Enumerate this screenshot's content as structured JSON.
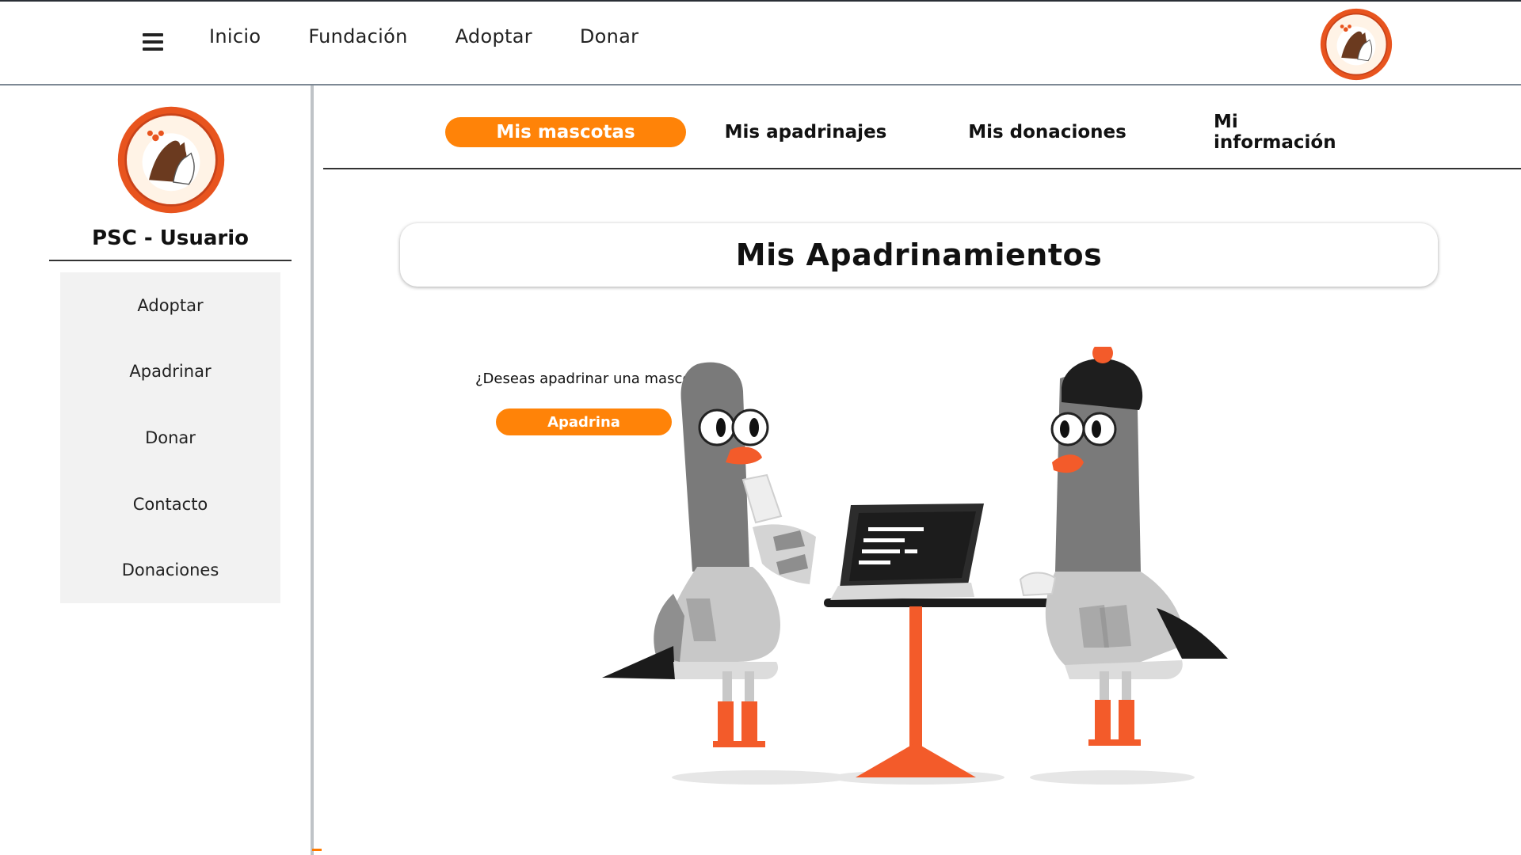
{
  "topbar": {
    "menu_icon": "hamburger-icon",
    "nav": [
      "Inicio",
      "Fundación",
      "Adoptar",
      "Donar"
    ],
    "logo_icon": "peluditos-logo"
  },
  "sidebar": {
    "logo_icon": "peluditos-logo",
    "title": "PSC - Usuario",
    "items": [
      "Adoptar",
      "Apadrinar",
      "Donar",
      "Contacto",
      "Donaciones"
    ]
  },
  "tabs": {
    "items": [
      "Mis mascotas",
      "Mis apadrinajes",
      "Mis donaciones",
      "Mi información"
    ],
    "active": "Mis mascotas"
  },
  "main": {
    "heading": "Mis Apadrinamientos",
    "prompt": "¿Deseas apadrinar una mascota?",
    "cta_label": "Apadrina"
  },
  "colors": {
    "accent": "#ff8308",
    "border": "#333333",
    "sidebar_bg": "#f2f2f2"
  }
}
